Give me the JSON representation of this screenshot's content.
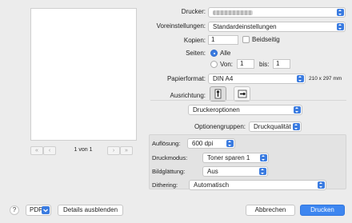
{
  "preview": {
    "page_label": "1 von 1",
    "first_label": "«",
    "prev_label": "‹",
    "next_label": "›",
    "last_label": "»"
  },
  "form": {
    "printer_label": "Drucker:",
    "presets_label": "Voreinstellungen:",
    "presets_value": "Standardeinstellungen",
    "copies_label": "Kopien:",
    "copies_value": "1",
    "duplex_label": "Beidseitig",
    "pages_label": "Seiten:",
    "pages_all_label": "Alle",
    "pages_from_label": "Von:",
    "pages_from_value": "1",
    "pages_to_label": "bis:",
    "pages_to_value": "1",
    "paper_label": "Papierformat:",
    "paper_value": "DIN A4",
    "paper_size": "210 x 297 mm",
    "orientation_label": "Ausrichtung:"
  },
  "section": {
    "value": "Druckeroptionen",
    "option_groups_label": "Optionengruppen:",
    "option_groups_value": "Druckqualität"
  },
  "quality": {
    "resolution_label": "Auflösung:",
    "resolution_value": "600 dpi",
    "mode_label": "Druckmodus:",
    "mode_value": "Toner sparen 1",
    "smoothing_label": "Bildglättung:",
    "smoothing_value": "Aus",
    "dithering_label": "Dithering:",
    "dithering_value": "Automatisch"
  },
  "footer": {
    "help_label": "?",
    "pdf_label": "PDF",
    "details_label": "Details ausblenden",
    "cancel_label": "Abbrechen",
    "print_label": "Drucken"
  },
  "colors": {
    "accent": "#3a7be0",
    "primary_button": "#3d86f0",
    "background": "#ececec"
  }
}
